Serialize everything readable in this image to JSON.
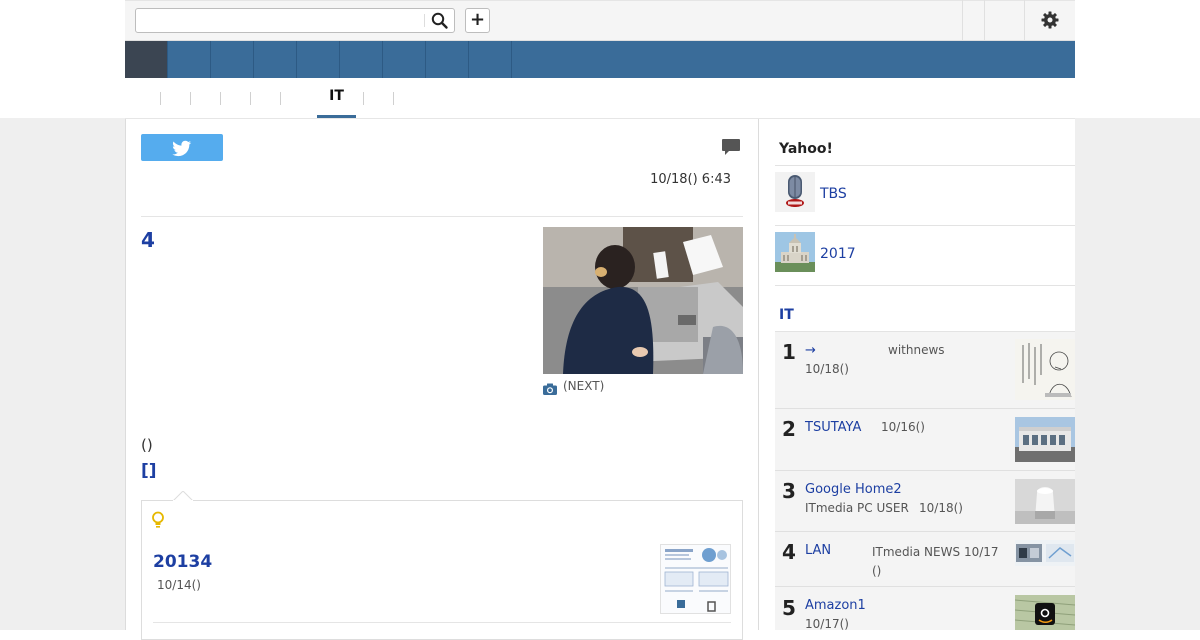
{
  "search": {
    "placeholder": "",
    "value": ""
  },
  "toolbar": {
    "add_label": "+"
  },
  "subnav": {
    "active_tab": "IT"
  },
  "article": {
    "date": "10/18() 6:43",
    "title": "4",
    "photo_caption": "(NEXT)",
    "paren_text": "()",
    "bracket_link": "[]"
  },
  "related": {
    "title": "20134",
    "date": "10/14()"
  },
  "sidebar": {
    "heading": "Yahoo!",
    "items": [
      {
        "label": "TBS",
        "icon": "tbs-news-microphone-thumbnail"
      },
      {
        "label": "2017",
        "icon": "diet-building-thumbnail"
      }
    ],
    "ranking_heading": "IT",
    "ranking": [
      {
        "rank": "1",
        "title": "→",
        "source": "withnews",
        "date": "10/18()"
      },
      {
        "rank": "2",
        "title": "TSUTAYA",
        "source": "",
        "date": "10/16()"
      },
      {
        "rank": "3",
        "title": "Google Home2",
        "source": "ITmedia PC USER",
        "date": "10/18()"
      },
      {
        "rank": "4",
        "title": "LAN",
        "source": "ITmedia NEWS",
        "date": "10/17()"
      },
      {
        "rank": "5",
        "title": "Amazon1",
        "source": "",
        "date": "10/17()"
      }
    ]
  },
  "colors": {
    "nav_blue": "#3a6c99",
    "nav_active": "#3b4552",
    "link_blue": "#1d3fa2",
    "twitter_blue": "#55acee"
  }
}
